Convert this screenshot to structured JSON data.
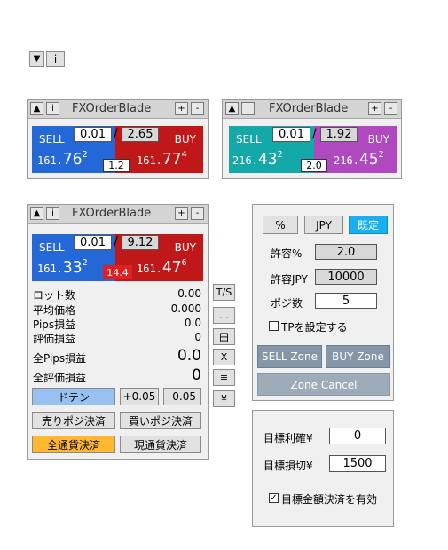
{
  "mini": {
    "collapse_icon": "▼",
    "info_label": "i"
  },
  "panel1": {
    "title": "FXOrderBlade",
    "expand_icon": "▲",
    "info_label": "i",
    "plus": "+",
    "minus": "-",
    "sell_label": "SELL",
    "buy_label": "BUY",
    "lot": "0.01",
    "slash": "/",
    "max": "2.65",
    "sell_a": "161.",
    "sell_b": "76",
    "sell_c": "2",
    "buy_a": "161.",
    "buy_b": "77",
    "buy_c": "4",
    "spread": "1.2",
    "colors": {
      "sell": "#2468d8",
      "buy": "#c01818"
    }
  },
  "panel2": {
    "title": "FXOrderBlade",
    "expand_icon": "▲",
    "info_label": "i",
    "plus": "+",
    "minus": "-",
    "sell_label": "SELL",
    "buy_label": "BUY",
    "lot": "0.01",
    "slash": "/",
    "max": "1.92",
    "sell_a": "216.",
    "sell_b": "43",
    "sell_c": "2",
    "buy_a": "216.",
    "buy_b": "45",
    "buy_c": "2",
    "spread": "2.0",
    "colors": {
      "sell": "#14a8a8",
      "buy": "#b048c0"
    }
  },
  "panel3": {
    "title": "FXOrderBlade",
    "expand_icon": "▲",
    "info_label": "i",
    "plus": "+",
    "minus": "-",
    "sell_label": "SELL",
    "buy_label": "BUY",
    "lot": "0.01",
    "slash": "/",
    "max": "9.12",
    "sell_a": "161.",
    "sell_b": "33",
    "sell_c": "2",
    "buy_a": "161.",
    "buy_b": "47",
    "buy_c": "6",
    "spread": "14.4",
    "stats": [
      {
        "k": "ロット数",
        "v": "0.00"
      },
      {
        "k": "平均価格",
        "v": "0.000"
      },
      {
        "k": "Pips損益",
        "v": "0.0"
      },
      {
        "k": "評価損益",
        "v": "0"
      }
    ],
    "total_pips": {
      "k": "全Pips損益",
      "v": "0.0"
    },
    "total_eval": {
      "k": "全評価損益",
      "v": "0"
    },
    "doten": "ドテン",
    "plus005": "+0.05",
    "minus005": "-0.05",
    "close_sell": "売りポジ決済",
    "close_buy": "買いポジ決済",
    "close_all": "全通貨決済",
    "close_current": "現通貨決済",
    "colors": {
      "sell": "#2468d8",
      "buy": "#c01818",
      "spread_bg": "#e02020",
      "doten_bg": "#98c0f0",
      "all_bg": "#ffb830"
    }
  },
  "sidebar": {
    "ts": "T/S",
    "dots": "…",
    "grid": "田",
    "x": "X",
    "menu": "≡",
    "yen": "¥"
  },
  "settings": {
    "percent": "%",
    "jpy": "JPY",
    "default": "既定",
    "allow_pct_label": "許容%",
    "allow_pct": "2.0",
    "allow_jpy_label": "許容JPY",
    "allow_jpy": "10000",
    "pos_label": "ポジ数",
    "pos": "5",
    "tp_label": "TPを設定する",
    "tp_checked": false,
    "sell_zone": "SELL Zone",
    "buy_zone": "BUY Zone",
    "zone_cancel": "Zone Cancel",
    "colors": {
      "default_bg": "#18b0f0",
      "zone": "#8496a8",
      "cancel": "#9eacba"
    }
  },
  "target": {
    "profit_label": "目標利確¥",
    "profit": "0",
    "loss_label": "目標損切¥",
    "loss": "1500",
    "enable_label": "目標金額決済を有効",
    "enable_checked": true
  }
}
